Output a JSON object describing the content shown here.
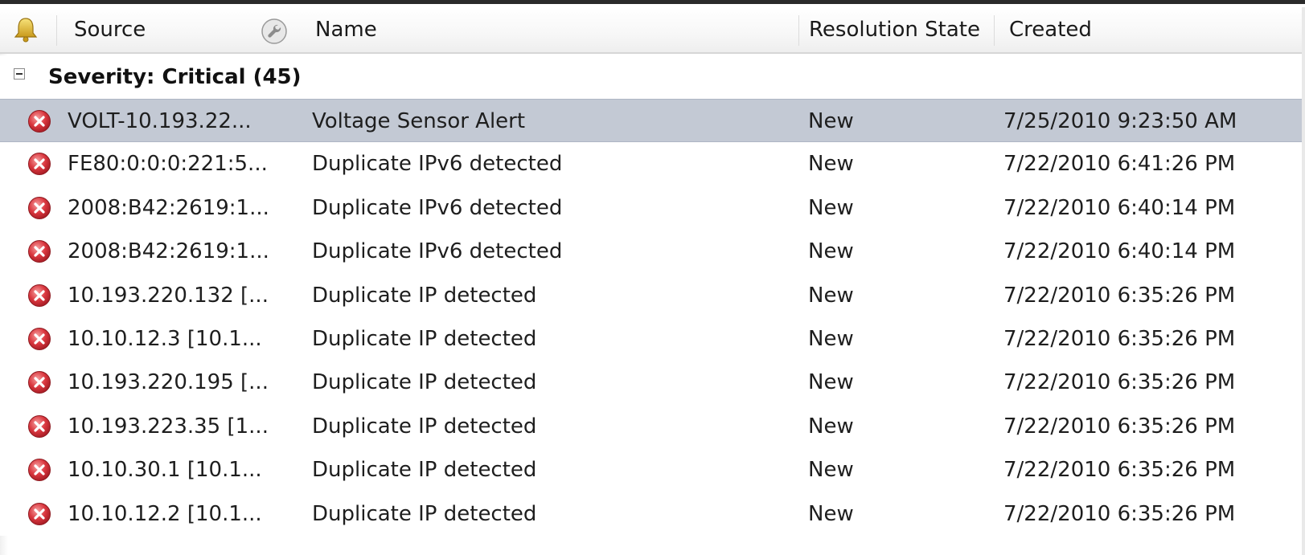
{
  "columns": {
    "alert_icon": "bell-icon",
    "source": "Source",
    "tool_icon": "wrench-icon",
    "name": "Name",
    "resolution_state": "Resolution State",
    "created": "Created"
  },
  "group": {
    "label": "Severity: Critical (45)",
    "expanded": true
  },
  "colors": {
    "selected_row": "#c3c9d4",
    "critical_icon": "#d9363e"
  },
  "rows": [
    {
      "icon": "critical-icon",
      "source": "VOLT-10.193.22...",
      "name": "Voltage Sensor Alert",
      "state": "New",
      "created": "7/25/2010 9:23:50 AM",
      "selected": true
    },
    {
      "icon": "critical-icon",
      "source": "FE80:0:0:0:221:5...",
      "name": "Duplicate IPv6 detected",
      "state": "New",
      "created": "7/22/2010 6:41:26 PM",
      "selected": false
    },
    {
      "icon": "critical-icon",
      "source": "2008:B42:2619:1...",
      "name": "Duplicate IPv6 detected",
      "state": "New",
      "created": "7/22/2010 6:40:14 PM",
      "selected": false
    },
    {
      "icon": "critical-icon",
      "source": "2008:B42:2619:1...",
      "name": "Duplicate IPv6 detected",
      "state": "New",
      "created": "7/22/2010 6:40:14 PM",
      "selected": false
    },
    {
      "icon": "critical-icon",
      "source": "10.193.220.132 [...",
      "name": "Duplicate IP detected",
      "state": "New",
      "created": "7/22/2010 6:35:26 PM",
      "selected": false
    },
    {
      "icon": "critical-icon",
      "source": "10.10.12.3 [10.1...",
      "name": "Duplicate IP detected",
      "state": "New",
      "created": "7/22/2010 6:35:26 PM",
      "selected": false
    },
    {
      "icon": "critical-icon",
      "source": "10.193.220.195 [...",
      "name": "Duplicate IP detected",
      "state": "New",
      "created": "7/22/2010 6:35:26 PM",
      "selected": false
    },
    {
      "icon": "critical-icon",
      "source": "10.193.223.35 [1...",
      "name": "Duplicate IP detected",
      "state": "New",
      "created": "7/22/2010 6:35:26 PM",
      "selected": false
    },
    {
      "icon": "critical-icon",
      "source": "10.10.30.1 [10.1...",
      "name": "Duplicate IP detected",
      "state": "New",
      "created": "7/22/2010 6:35:26 PM",
      "selected": false
    },
    {
      "icon": "critical-icon",
      "source": "10.10.12.2 [10.1...",
      "name": "Duplicate IP detected",
      "state": "New",
      "created": "7/22/2010 6:35:26 PM",
      "selected": false
    }
  ]
}
